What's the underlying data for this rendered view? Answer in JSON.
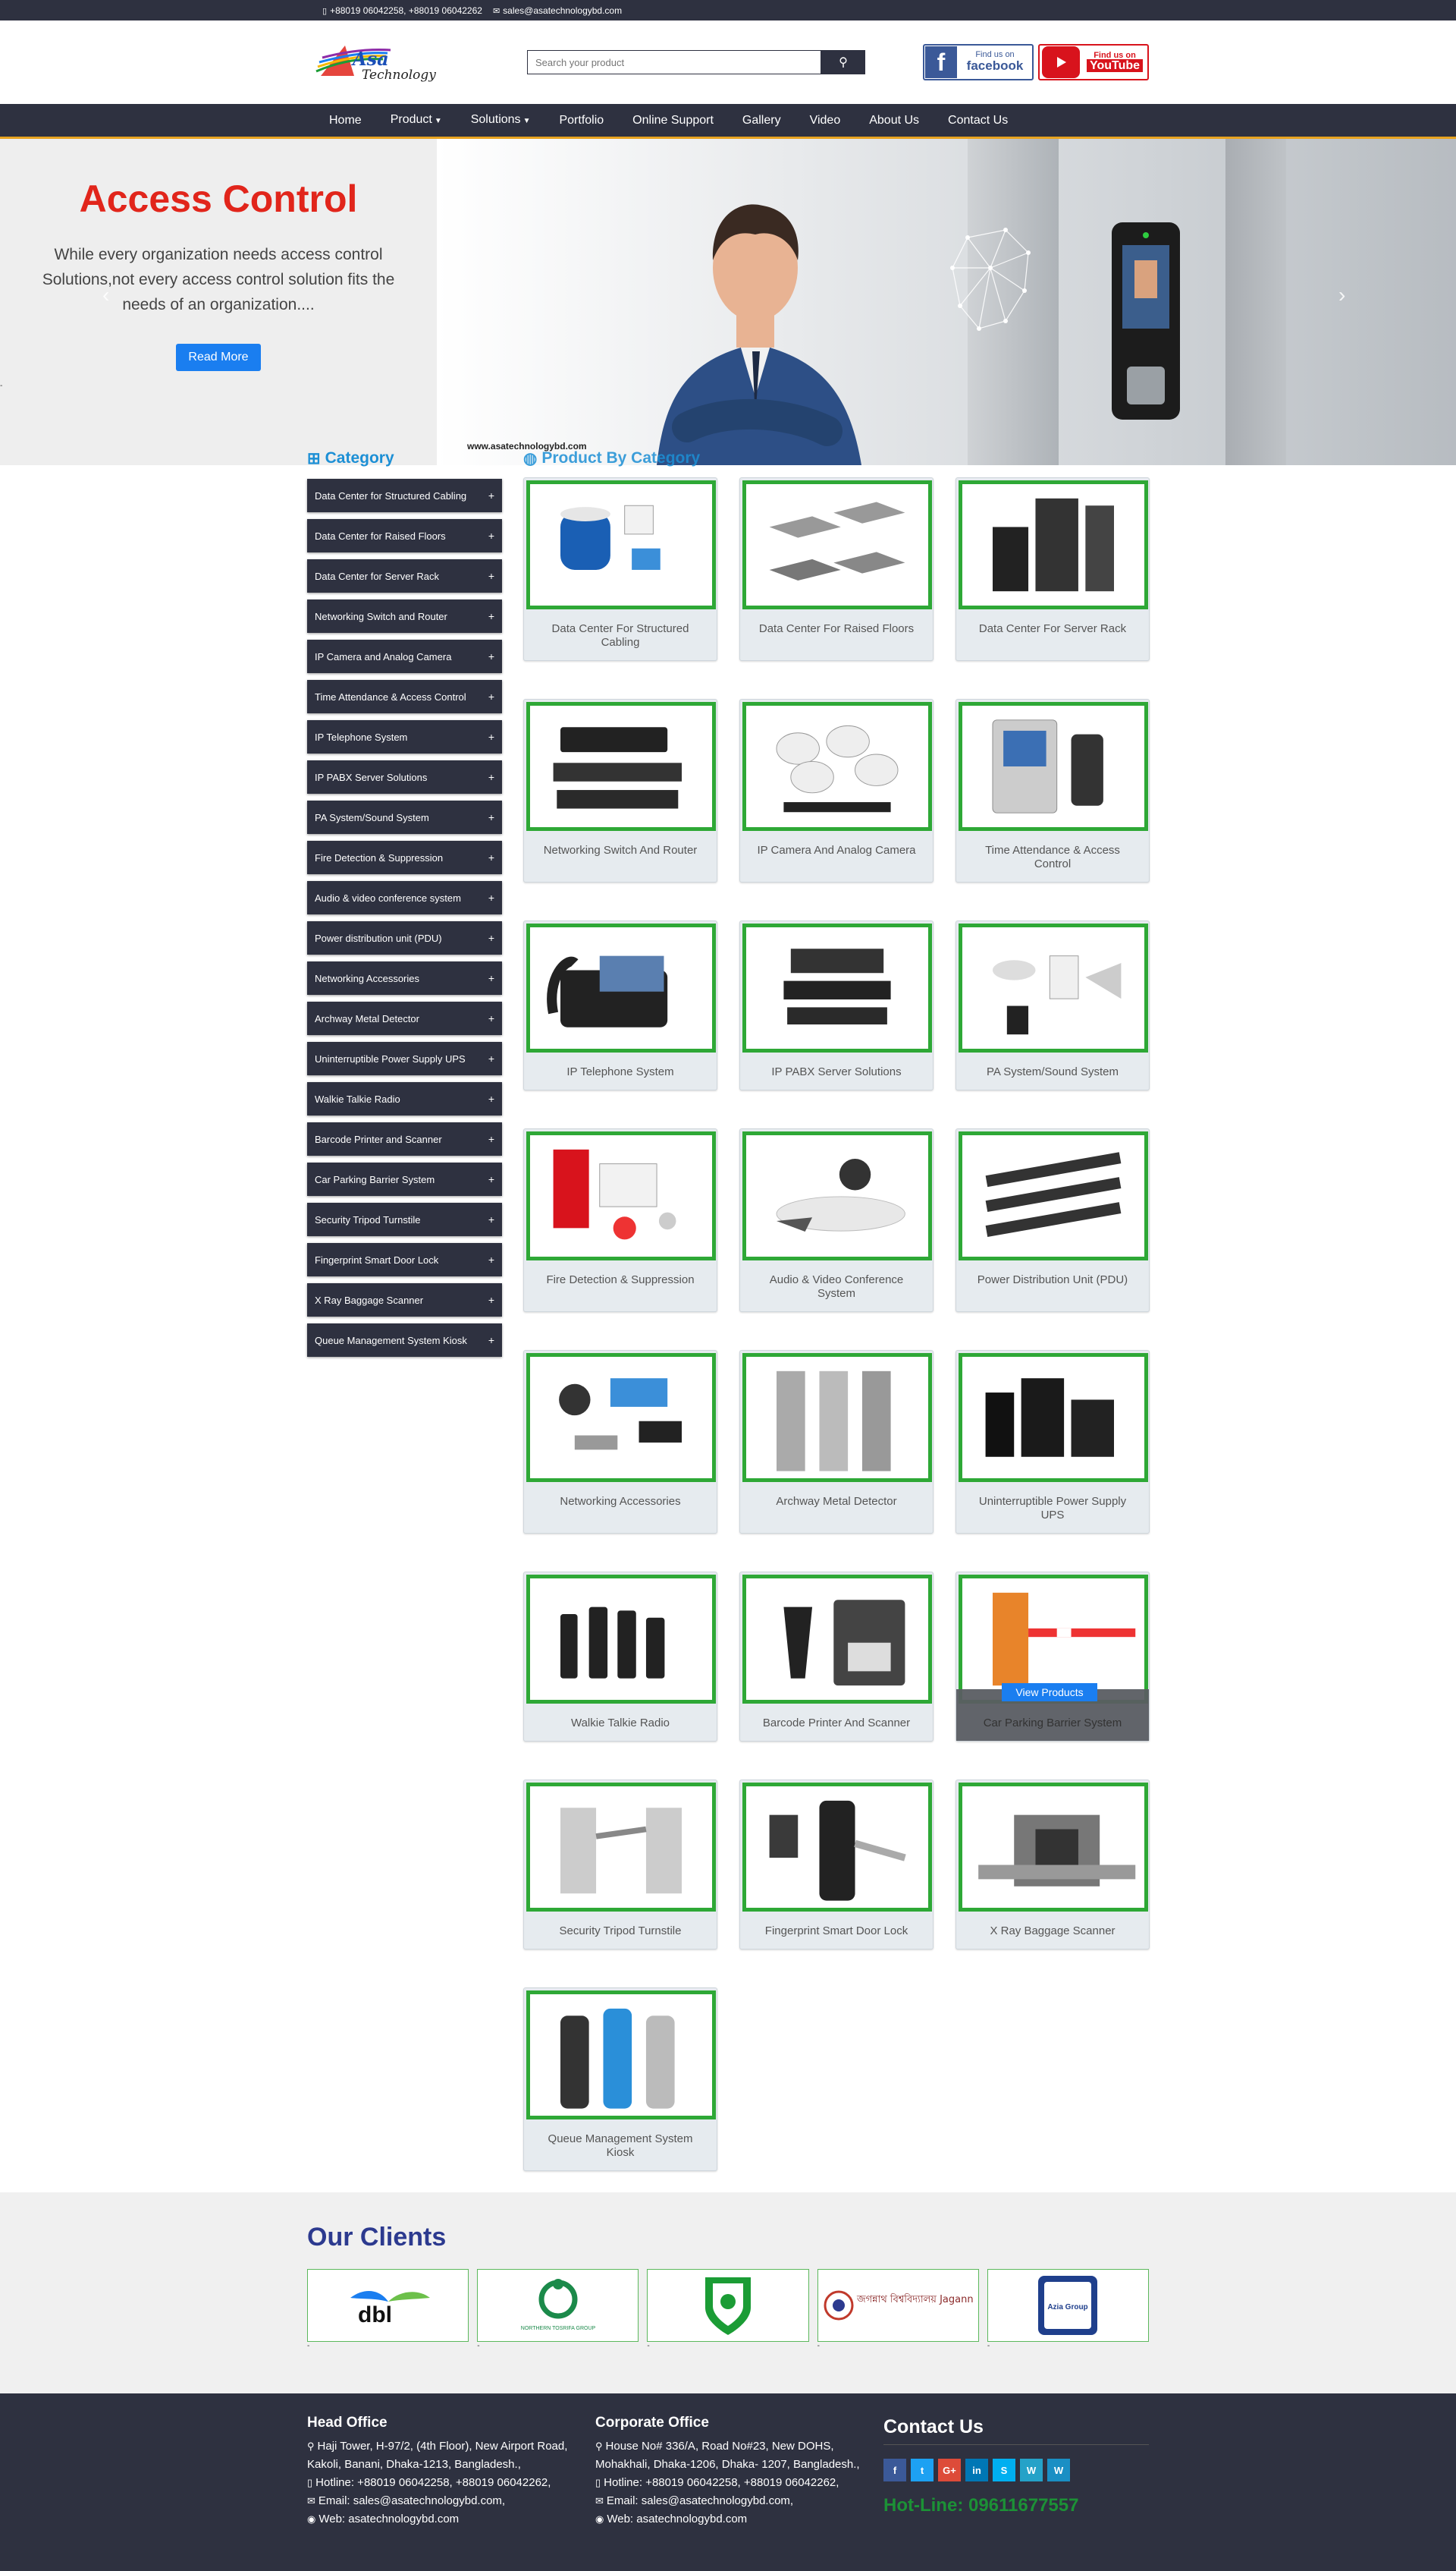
{
  "topbar": {
    "phones": "+88019 06042258, +88019 06042262",
    "email": "sales@asatechnologybd.com"
  },
  "brand": {
    "logo_text_1": "Asa",
    "logo_text_2": "Technology"
  },
  "search": {
    "placeholder": "Search your product"
  },
  "social_badges": {
    "fb_small": "Find us on",
    "fb_big": "facebook",
    "yt_small": "Find us on",
    "yt_big": "YouTube"
  },
  "nav": {
    "items": [
      "Home",
      "Product",
      "Solutions",
      "Portfolio",
      "Online Support",
      "Gallery",
      "Video",
      "About Us",
      "Contact Us"
    ]
  },
  "hero": {
    "title": "Access Control",
    "text": "While every organization needs access control Solutions,not every access control solution fits the needs of an organization....",
    "button": "Read More",
    "watermark": "www.asatechnologybd.com",
    "dash": "-"
  },
  "sidebar": {
    "title": "Category",
    "items": [
      "Data Center for Structured Cabling",
      "Data Center for Raised Floors",
      "Data Center for Server Rack",
      "Networking Switch and Router",
      "IP Camera and Analog Camera",
      "Time Attendance & Access Control",
      "IP Telephone System",
      "IP PABX Server Solutions",
      "PA System/Sound System",
      "Fire Detection & Suppression",
      "Audio & video conference system",
      "Power distribution unit (PDU)",
      "Networking Accessories",
      "Archway Metal Detector",
      "Uninterruptible Power Supply UPS",
      "Walkie Talkie Radio",
      "Barcode Printer and Scanner",
      "Car Parking Barrier System",
      "Security Tripod Turnstile",
      "Fingerprint Smart Door Lock",
      "X Ray Baggage Scanner",
      "Queue Management System Kiosk"
    ],
    "plus": "+"
  },
  "products": {
    "title": "Product By Category",
    "view_products": "View Products",
    "items": [
      "Data Center For Structured Cabling",
      "Data Center For Raised Floors",
      "Data Center For Server Rack",
      "Networking Switch And Router",
      "IP Camera And Analog Camera",
      "Time Attendance & Access Control",
      "IP Telephone System",
      "IP PABX Server Solutions",
      "PA System/Sound System",
      "Fire Detection & Suppression",
      "Audio & Video Conference System",
      "Power Distribution Unit (PDU)",
      "Networking Accessories",
      "Archway Metal Detector",
      "Uninterruptible Power Supply UPS",
      "Walkie Talkie Radio",
      "Barcode Printer And Scanner",
      "Car Parking Barrier System",
      "Security Tripod Turnstile",
      "Fingerprint Smart Door Lock",
      "X Ray Baggage Scanner",
      "Queue Management System Kiosk"
    ]
  },
  "clients": {
    "title": "Our Clients",
    "logos": [
      "dbl",
      "NORTHERN TOSRIFA GROUP",
      "",
      "জগন্নাথ বিশ্ববিদ্যালয় Jagannath University",
      "Azia Group"
    ],
    "dash": "-"
  },
  "footer": {
    "head_office": {
      "title": "Head Office",
      "address": "Haji Tower, H-97/2, (4th Floor), New Airport Road, Kakoli, Banani, Dhaka-1213, Bangladesh.,",
      "hotline": "Hotline: +88019 06042258, +88019 06042262,",
      "email": "Email: sales@asatechnologybd.com,",
      "web": "Web: asatechnologybd.com"
    },
    "corporate_office": {
      "title": "Corporate Office",
      "address": "House No# 336/A, Road No#23, New DOHS, Mohakhali, Dhaka-1206, Dhaka- 1207, Bangladesh.,",
      "hotline": "Hotline: +88019 06042258, +88019 06042262,",
      "email": "Email: sales@asatechnologybd.com,",
      "web": "Web: asatechnologybd.com"
    },
    "contact": {
      "title": "Contact Us",
      "social": [
        "f",
        "t",
        "G+",
        "in",
        "S",
        "W",
        "W"
      ],
      "hotline": "Hot-Line: 09611677557"
    }
  },
  "colors": {
    "dark": "#2e3140",
    "accent_blue": "#1a7ef0",
    "hero_red": "#e1251b",
    "card_border_green": "#2ea836",
    "clients_title": "#2c3a8f",
    "hotline_green": "#1b9c35"
  }
}
